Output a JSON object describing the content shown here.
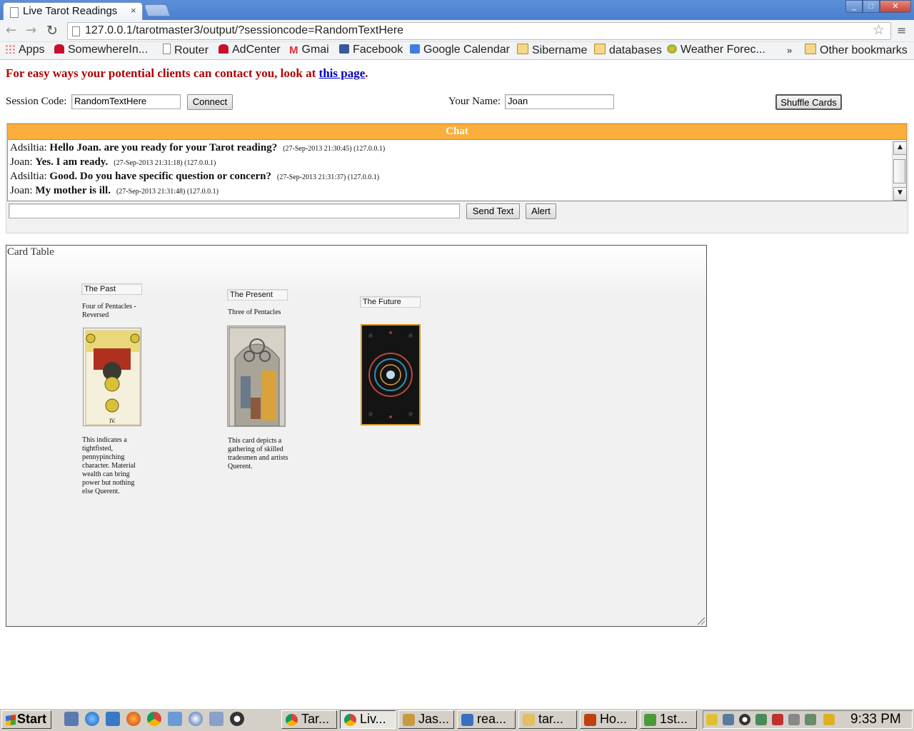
{
  "browser": {
    "tab_title": "Live Tarot Readings",
    "tab_close": "×",
    "url": "127.0.0.1/tarotmaster3/output/?sessioncode=RandomTextHere",
    "bookmarks": {
      "apps": "Apps",
      "somewhere": "SomewhereIn...",
      "router": "Router",
      "adcenter": "AdCenter",
      "gmail": "Gmai",
      "facebook": "Facebook",
      "gcal": "Google Calendar",
      "sibername": "Sibername",
      "databases": "databases",
      "weather": "Weather Forec...",
      "overflow": "»",
      "other": "Other bookmarks"
    }
  },
  "page": {
    "promo_text": "For easy ways your potential clients can contact you, look at ",
    "promo_link": "this page",
    "promo_end": ".",
    "session_label": "Session Code:",
    "session_value": "RandomTextHere",
    "connect_label": "Connect",
    "name_label": "Your Name:",
    "name_value": "Joan",
    "shuffle_label": "Shuffle Cards"
  },
  "chat": {
    "header": "Chat",
    "messages": [
      {
        "sender": "Adsiltia:",
        "text": "Hello Joan. are you ready for your Tarot reading?",
        "meta": "(27-Sep-2013 21:30:45) (127.0.0.1)"
      },
      {
        "sender": "Joan:",
        "text": "Yes. I am ready.",
        "meta": "(27-Sep-2013 21:31:18) (127.0.0.1)"
      },
      {
        "sender": "Adsiltia:",
        "text": "Good. Do you have specific question or concern?",
        "meta": "(27-Sep-2013 21:31:37) (127.0.0.1)"
      },
      {
        "sender": "Joan:",
        "text": "My mother is ill.",
        "meta": "(27-Sep-2013 21:31:48) (127.0.0.1)"
      }
    ],
    "input_value": "",
    "send_label": "Send Text",
    "alert_label": "Alert",
    "scroll_up": "▲",
    "scroll_down": "▼"
  },
  "card_table": {
    "title": "Card Table",
    "past": {
      "label": "The Past",
      "name": "Four of Pentacles - Reversed",
      "description": "This indicates a tightfisted, pennypinching character. Material wealth can bring power but nothing else Querent."
    },
    "present": {
      "label": "The Present",
      "name": "Three of Pentacles",
      "description": "This card depicts a gathering of skilled tradesmen and artists Querent."
    },
    "future": {
      "label": "The Future"
    }
  },
  "taskbar": {
    "start": "Start",
    "tasks": [
      "Tar...",
      "Liv...",
      "Jas...",
      "rea...",
      "tar...",
      "Ho...",
      "1st..."
    ],
    "clock": "9:33 PM"
  },
  "colors": {
    "chat_header": "#fbae3c",
    "promo": "#b00000",
    "link": "#0000c0"
  }
}
